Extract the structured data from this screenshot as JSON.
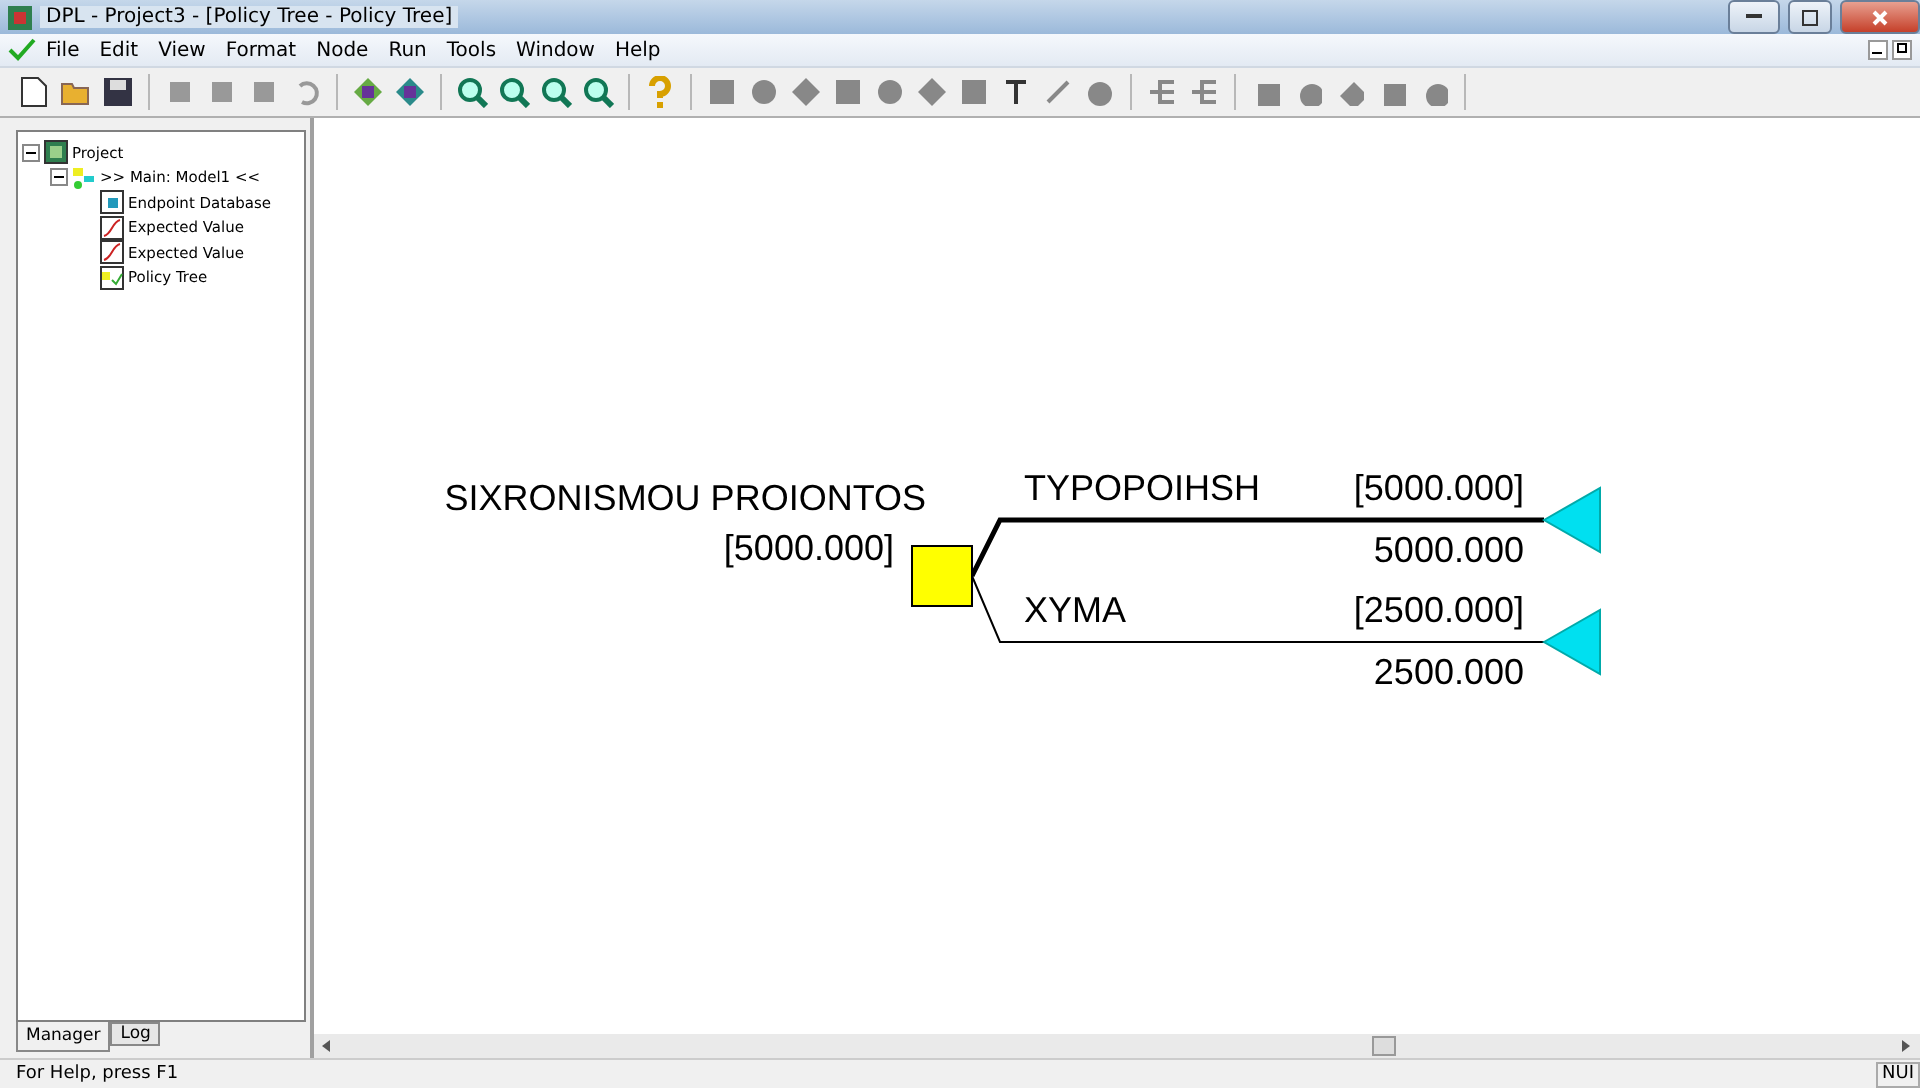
{
  "window": {
    "title": "DPL - Project3 - [Policy Tree - Policy Tree]"
  },
  "menu": [
    "File",
    "Edit",
    "View",
    "Format",
    "Node",
    "Run",
    "Tools",
    "Window",
    "Help"
  ],
  "tree": {
    "label": "Project",
    "expanded": true,
    "children": [
      {
        "label": ">> Main: Model1 <<",
        "expanded": true,
        "children": [
          {
            "label": "Endpoint Database",
            "kind": "database"
          },
          {
            "label": "Expected Value",
            "kind": "curve"
          },
          {
            "label": "Expected Value",
            "kind": "curve"
          },
          {
            "label": "Policy Tree",
            "kind": "policy"
          }
        ]
      }
    ]
  },
  "panel_tabs": [
    {
      "label": "Manager",
      "selected": true
    },
    {
      "label": "Log",
      "selected": false
    }
  ],
  "diagram": {
    "decision": {
      "label": "SIXRONISMOU PROIONTOS",
      "value": "[5000.000]"
    },
    "branches": [
      {
        "label": "TYPOPOIHSH",
        "value": "[5000.000]",
        "payoff": "5000.000",
        "optimal": true
      },
      {
        "label": "XYMA",
        "value": "[2500.000]",
        "payoff": "2500.000",
        "optimal": false
      }
    ]
  },
  "status_bar": {
    "message": "For Help, press F1",
    "indicator": "NUI"
  }
}
